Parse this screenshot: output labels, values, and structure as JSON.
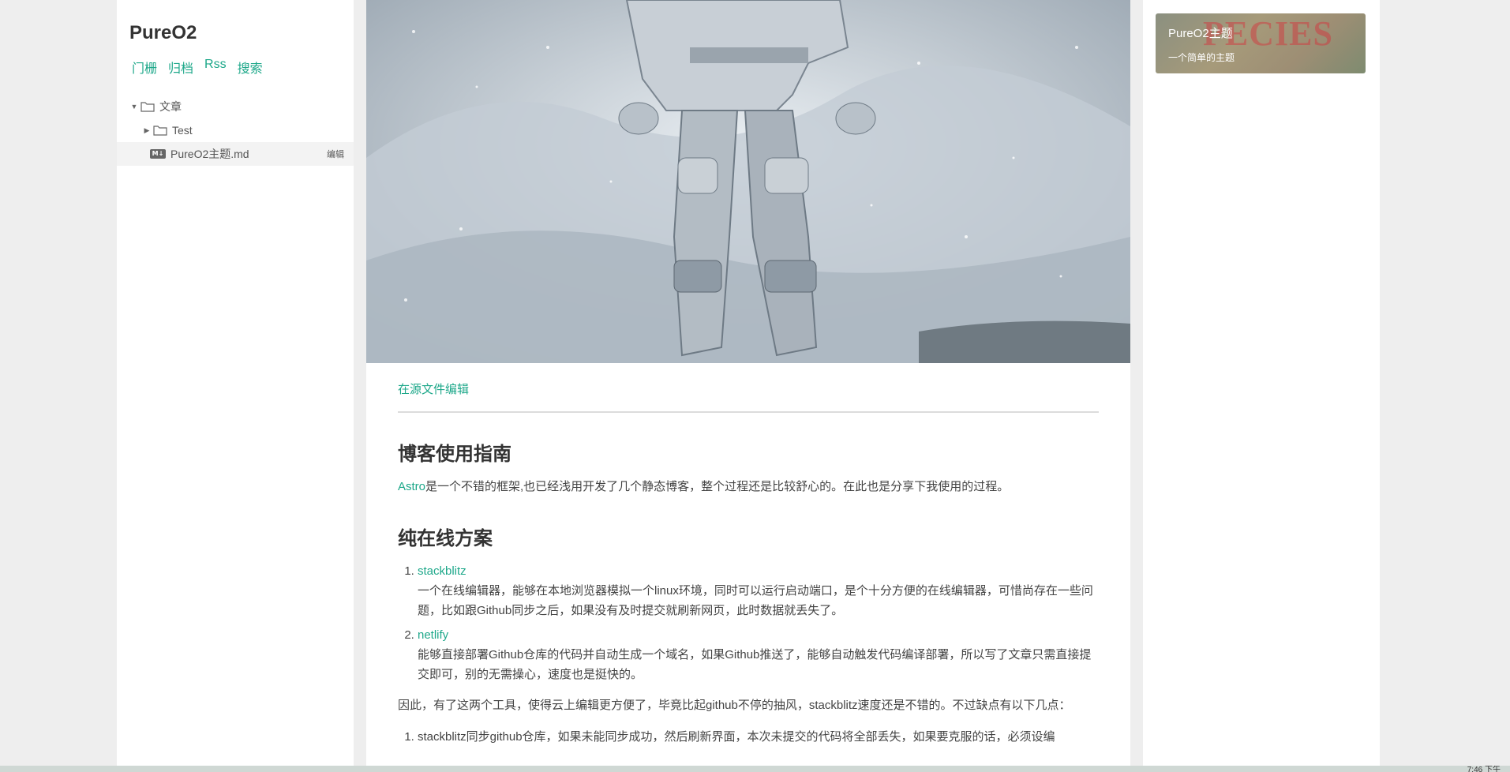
{
  "site": {
    "title": "PureO2"
  },
  "nav": [
    "门栅",
    "归档",
    "Rss",
    "搜索"
  ],
  "tree": {
    "root_folder": "文章",
    "sub_folder": "Test",
    "file": "PureO2主题.md",
    "file_edit": "编辑",
    "md_badge": "M↓"
  },
  "main": {
    "source_edit": "在源文件编辑",
    "h1": "博客使用指南",
    "intro_link": "Astro",
    "intro_text": "是一个不错的框架,也已经浅用开发了几个静态博客，整个过程还是比较舒心的。在此也是分享下我使用的过程。",
    "h2": "纯在线方案",
    "items": [
      {
        "link": "stackblitz",
        "text": "一个在线编辑器，能够在本地浏览器模拟一个linux环境，同时可以运行启动端口，是个十分方便的在线编辑器，可惜尚存在一些问题，比如跟Github同步之后，如果没有及时提交就刷新网页，此时数据就丢失了。"
      },
      {
        "link": "netlify",
        "text": "能够直接部署Github仓库的代码并自动生成一个域名，如果Github推送了，能够自动触发代码编译部署，所以写了文章只需直接提交即可，别的无需操心，速度也是挺快的。"
      }
    ],
    "summary": "因此，有了这两个工具，使得云上编辑更方便了，毕竟比起github不停的抽风，stackblitz速度还是不错的。不过缺点有以下几点：",
    "partial_item": "stackblitz同步github仓库，如果未能同步成功，然后刷新界面，本次未提交的代码将全部丢失，如果要克服的话，必须设编"
  },
  "profile": {
    "title": "PureO2主题",
    "desc": "一个简单的主题",
    "bg_text": "PECIES"
  },
  "taskbar": {
    "clock": "7:46 下午"
  },
  "colors": {
    "accent": "#1ea88a",
    "page_bg": "#eeeeee"
  }
}
